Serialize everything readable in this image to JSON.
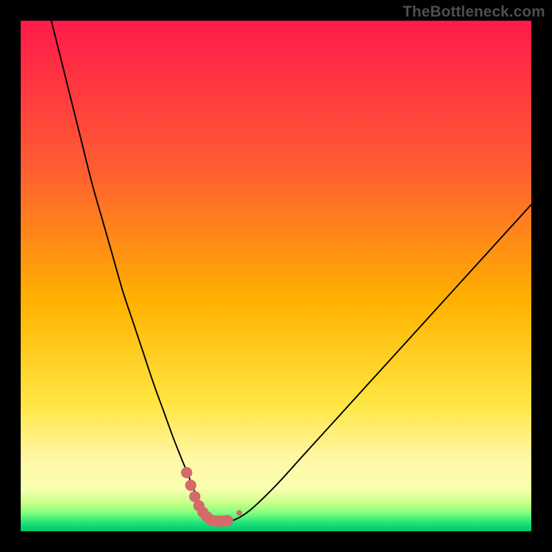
{
  "watermark": "TheBottleneck.com",
  "colors": {
    "frame_bg": "#000000",
    "curve_stroke": "#000000",
    "marker_fill": "#d46a6a",
    "gradient_stops": [
      {
        "offset": 0.0,
        "color": "#ff1a4b"
      },
      {
        "offset": 0.28,
        "color": "#ff5a33"
      },
      {
        "offset": 0.55,
        "color": "#ffb200"
      },
      {
        "offset": 0.75,
        "color": "#ffe642"
      },
      {
        "offset": 0.86,
        "color": "#fff7a8"
      },
      {
        "offset": 0.915,
        "color": "#faffb0"
      },
      {
        "offset": 0.945,
        "color": "#c8ff8a"
      },
      {
        "offset": 0.965,
        "color": "#7dff7d"
      },
      {
        "offset": 0.985,
        "color": "#18e07a"
      },
      {
        "offset": 1.0,
        "color": "#00c765"
      }
    ]
  },
  "chart_data": {
    "type": "line",
    "title": "",
    "xlabel": "",
    "ylabel": "",
    "xlim": [
      0,
      100
    ],
    "ylim": [
      0,
      100
    ],
    "grid": false,
    "series": [
      {
        "name": "bottleneck-curve",
        "x": [
          6,
          8,
          10,
          12,
          14,
          16,
          18,
          20,
          22,
          24,
          26,
          28,
          30,
          32,
          33,
          34,
          35,
          36,
          37,
          38,
          40,
          42,
          45,
          50,
          55,
          60,
          65,
          70,
          75,
          80,
          85,
          90,
          95,
          100
        ],
        "values": [
          100,
          92,
          84,
          76,
          68,
          61,
          54,
          47,
          41,
          35,
          29,
          23.5,
          18,
          13,
          10.5,
          8,
          5.8,
          4,
          2.7,
          2,
          2,
          2.3,
          4.2,
          9,
          14.5,
          20,
          25.5,
          31,
          36.5,
          42,
          47.5,
          53,
          58.5,
          64
        ]
      }
    ],
    "markers": {
      "name": "highlight-band",
      "x": [
        32.5,
        33.3,
        34.1,
        34.9,
        35.7,
        36.5,
        37.3,
        38.1,
        38.9,
        39.7,
        40.5,
        42.8
      ],
      "values": [
        11.5,
        9.0,
        6.8,
        5.0,
        3.7,
        2.8,
        2.2,
        2.0,
        2.0,
        2.0,
        2.1,
        3.6
      ],
      "radius": [
        1.1,
        1.1,
        1.1,
        1.1,
        1.1,
        1.1,
        1.1,
        1.1,
        1.1,
        1.1,
        1.1,
        0.55
      ]
    }
  }
}
